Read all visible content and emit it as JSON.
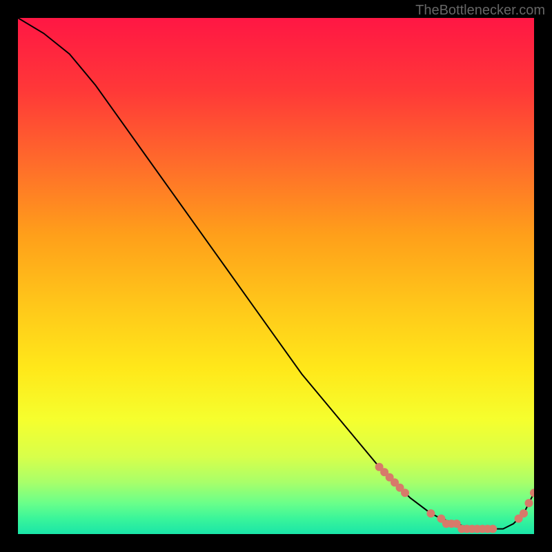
{
  "watermark": "TheBottlenecker.com",
  "chart_data": {
    "type": "line",
    "title": "",
    "xlabel": "",
    "ylabel": "",
    "xlim": [
      0,
      100
    ],
    "ylim": [
      0,
      100
    ],
    "background": "rainbow-gradient-red-to-green",
    "series": [
      {
        "name": "bottleneck-curve",
        "color": "#000000",
        "x": [
          0,
          5,
          10,
          15,
          20,
          25,
          30,
          35,
          40,
          45,
          50,
          55,
          60,
          65,
          70,
          73,
          76,
          80,
          82,
          85,
          88,
          90,
          92,
          94,
          96,
          98,
          100
        ],
        "y": [
          100,
          97,
          93,
          87,
          80,
          73,
          66,
          59,
          52,
          45,
          38,
          31,
          25,
          19,
          13,
          10,
          7,
          4,
          3,
          2,
          1,
          1,
          1,
          1,
          2,
          4,
          8
        ]
      }
    ],
    "markers": {
      "color": "#d77a6a",
      "points": [
        {
          "x": 70,
          "y": 13
        },
        {
          "x": 71,
          "y": 12
        },
        {
          "x": 72,
          "y": 11
        },
        {
          "x": 73,
          "y": 10
        },
        {
          "x": 74,
          "y": 9
        },
        {
          "x": 75,
          "y": 8
        },
        {
          "x": 80,
          "y": 4
        },
        {
          "x": 82,
          "y": 3
        },
        {
          "x": 83,
          "y": 2
        },
        {
          "x": 84,
          "y": 2
        },
        {
          "x": 85,
          "y": 2
        },
        {
          "x": 86,
          "y": 1
        },
        {
          "x": 87,
          "y": 1
        },
        {
          "x": 88,
          "y": 1
        },
        {
          "x": 89,
          "y": 1
        },
        {
          "x": 90,
          "y": 1
        },
        {
          "x": 91,
          "y": 1
        },
        {
          "x": 92,
          "y": 1
        },
        {
          "x": 97,
          "y": 3
        },
        {
          "x": 98,
          "y": 4
        },
        {
          "x": 99,
          "y": 6
        },
        {
          "x": 100,
          "y": 8
        }
      ]
    },
    "gradient_stops": [
      {
        "offset": 0,
        "color": "#ff1744"
      },
      {
        "offset": 14,
        "color": "#ff3838"
      },
      {
        "offset": 28,
        "color": "#ff6b2b"
      },
      {
        "offset": 42,
        "color": "#ff9f1a"
      },
      {
        "offset": 56,
        "color": "#ffc81a"
      },
      {
        "offset": 68,
        "color": "#ffe81a"
      },
      {
        "offset": 78,
        "color": "#f5ff2e"
      },
      {
        "offset": 85,
        "color": "#d8ff4a"
      },
      {
        "offset": 90,
        "color": "#a8ff6a"
      },
      {
        "offset": 94,
        "color": "#6aff8a"
      },
      {
        "offset": 97,
        "color": "#3af59a"
      },
      {
        "offset": 100,
        "color": "#1ae5a8"
      }
    ]
  }
}
